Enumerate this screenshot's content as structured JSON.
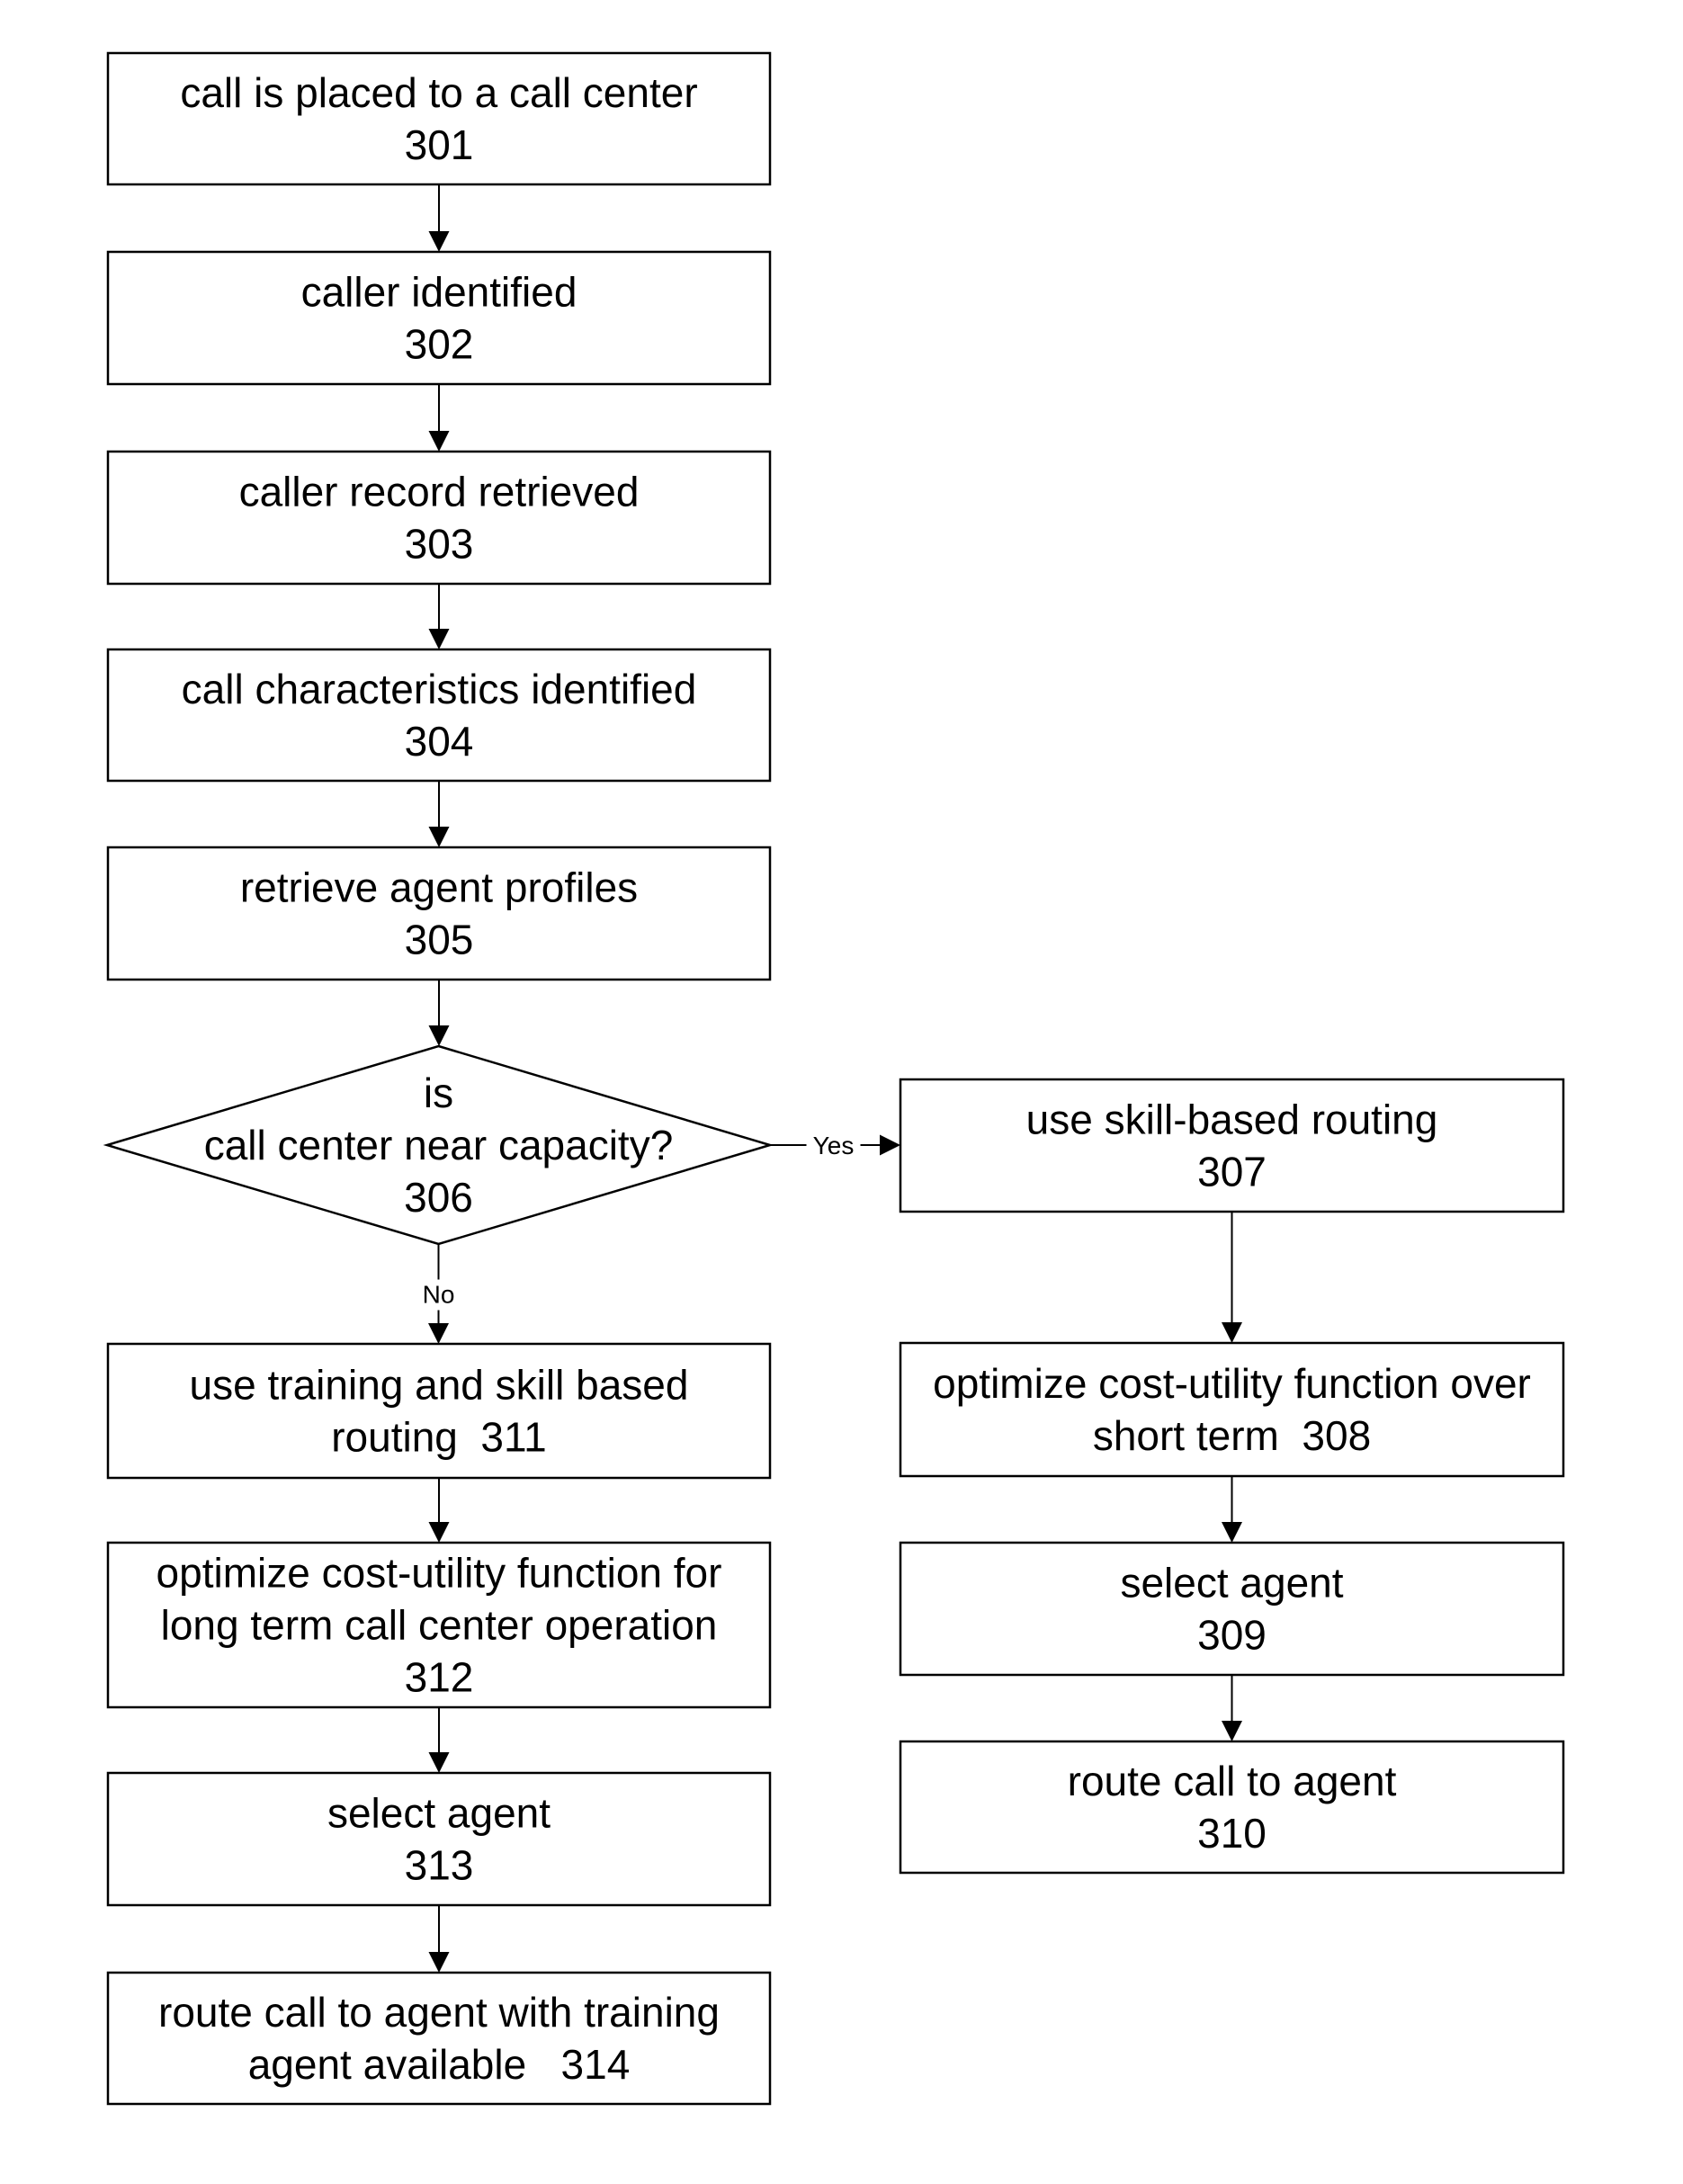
{
  "diagram": {
    "type": "flowchart",
    "nodes": [
      {
        "id": "301",
        "shape": "process",
        "lines": [
          "call is placed to a call center",
          "301"
        ]
      },
      {
        "id": "302",
        "shape": "process",
        "lines": [
          "caller identified",
          "302"
        ]
      },
      {
        "id": "303",
        "shape": "process",
        "lines": [
          "caller record retrieved",
          "303"
        ]
      },
      {
        "id": "304",
        "shape": "process",
        "lines": [
          "call characteristics identified",
          "304"
        ]
      },
      {
        "id": "305",
        "shape": "process",
        "lines": [
          "retrieve agent profiles",
          "305"
        ]
      },
      {
        "id": "306",
        "shape": "decision",
        "lines": [
          "is",
          "call center near capacity?",
          "306"
        ]
      },
      {
        "id": "307",
        "shape": "process",
        "lines": [
          "use skill-based routing",
          "307"
        ]
      },
      {
        "id": "308",
        "shape": "process",
        "lines": [
          "optimize cost-utility function over",
          "short term  308"
        ]
      },
      {
        "id": "309",
        "shape": "process",
        "lines": [
          "select agent",
          "309"
        ]
      },
      {
        "id": "310",
        "shape": "process",
        "lines": [
          "route call to agent",
          "310"
        ]
      },
      {
        "id": "311",
        "shape": "process",
        "lines": [
          "use training and skill based",
          "routing  311"
        ]
      },
      {
        "id": "312",
        "shape": "process",
        "lines": [
          "optimize cost-utility function for",
          "long term call center operation",
          "312"
        ]
      },
      {
        "id": "313",
        "shape": "process",
        "lines": [
          "select agent",
          "313"
        ]
      },
      {
        "id": "314",
        "shape": "process",
        "lines": [
          "route call to agent with training",
          "agent available   314"
        ]
      }
    ],
    "edges": [
      {
        "from": "301",
        "to": "302",
        "label": ""
      },
      {
        "from": "302",
        "to": "303",
        "label": ""
      },
      {
        "from": "303",
        "to": "304",
        "label": ""
      },
      {
        "from": "304",
        "to": "305",
        "label": ""
      },
      {
        "from": "305",
        "to": "306",
        "label": ""
      },
      {
        "from": "306",
        "to": "307",
        "label": "Yes"
      },
      {
        "from": "306",
        "to": "311",
        "label": "No"
      },
      {
        "from": "307",
        "to": "308",
        "label": ""
      },
      {
        "from": "308",
        "to": "309",
        "label": ""
      },
      {
        "from": "309",
        "to": "310",
        "label": ""
      },
      {
        "from": "311",
        "to": "312",
        "label": ""
      },
      {
        "from": "312",
        "to": "313",
        "label": ""
      },
      {
        "from": "313",
        "to": "314",
        "label": ""
      }
    ]
  }
}
